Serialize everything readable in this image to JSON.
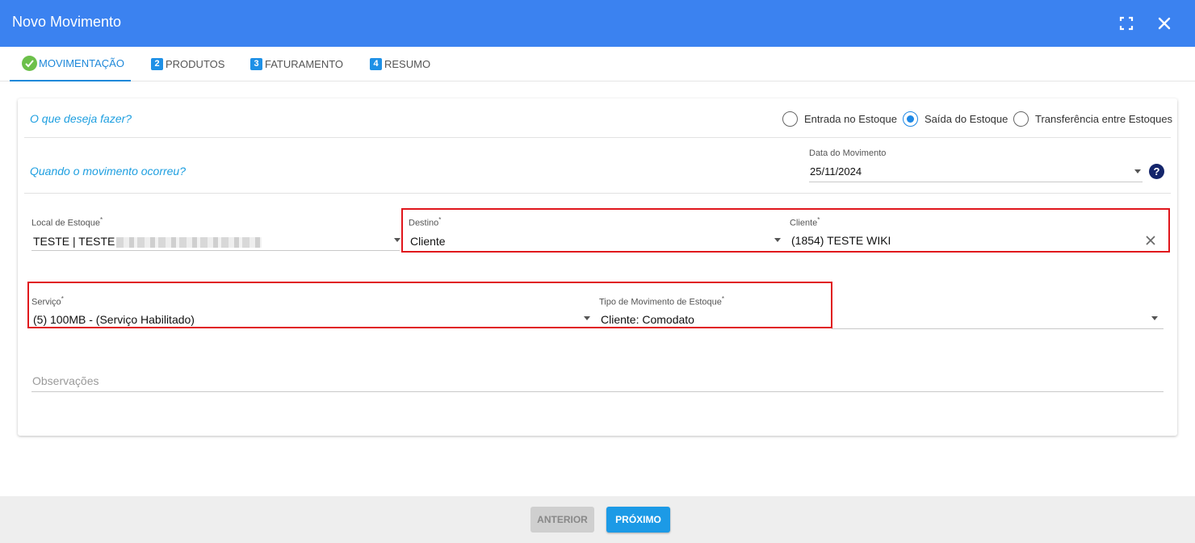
{
  "window": {
    "title": "Novo Movimento",
    "fullscreen_icon": "fullscreen-icon",
    "close_icon": "close-icon"
  },
  "tabs": [
    {
      "label": "MOVIMENTAÇÃO",
      "badge": "",
      "active": true
    },
    {
      "label": "PRODUTOS",
      "badge": "2",
      "active": false
    },
    {
      "label": "FATURAMENTO",
      "badge": "3",
      "active": false
    },
    {
      "label": "RESUMO",
      "badge": "4",
      "active": false
    }
  ],
  "form": {
    "question_what": "O que deseja fazer?",
    "options": [
      {
        "label": "Entrada no Estoque",
        "selected": false
      },
      {
        "label": "Saída do Estoque",
        "selected": true
      },
      {
        "label": "Transferência entre Estoques",
        "selected": false
      }
    ],
    "question_when": "Quando o movimento ocorreu?",
    "date_label": "Data do Movimento",
    "date_value": "25/11/2024",
    "help_label": "?",
    "local_label": "Local de Estoque",
    "local_value": "TESTE | TESTE",
    "destino_label": "Destino",
    "destino_value": "Cliente",
    "cliente_label": "Cliente",
    "cliente_value": "(1854) TESTE WIKI",
    "servico_label": "Serviço",
    "servico_value": "(5) 100MB - (Serviço Habilitado)",
    "tipo_label": "Tipo de Movimento de Estoque",
    "tipo_value": "Cliente: Comodato",
    "required_mark": "*",
    "obs_placeholder": "Observações"
  },
  "footer": {
    "prev_label": "ANTERIOR",
    "next_label": "PRÓXIMO"
  },
  "colors": {
    "header": "#3b82f0",
    "accent": "#1e88e5",
    "highlight": "#e0161c"
  }
}
